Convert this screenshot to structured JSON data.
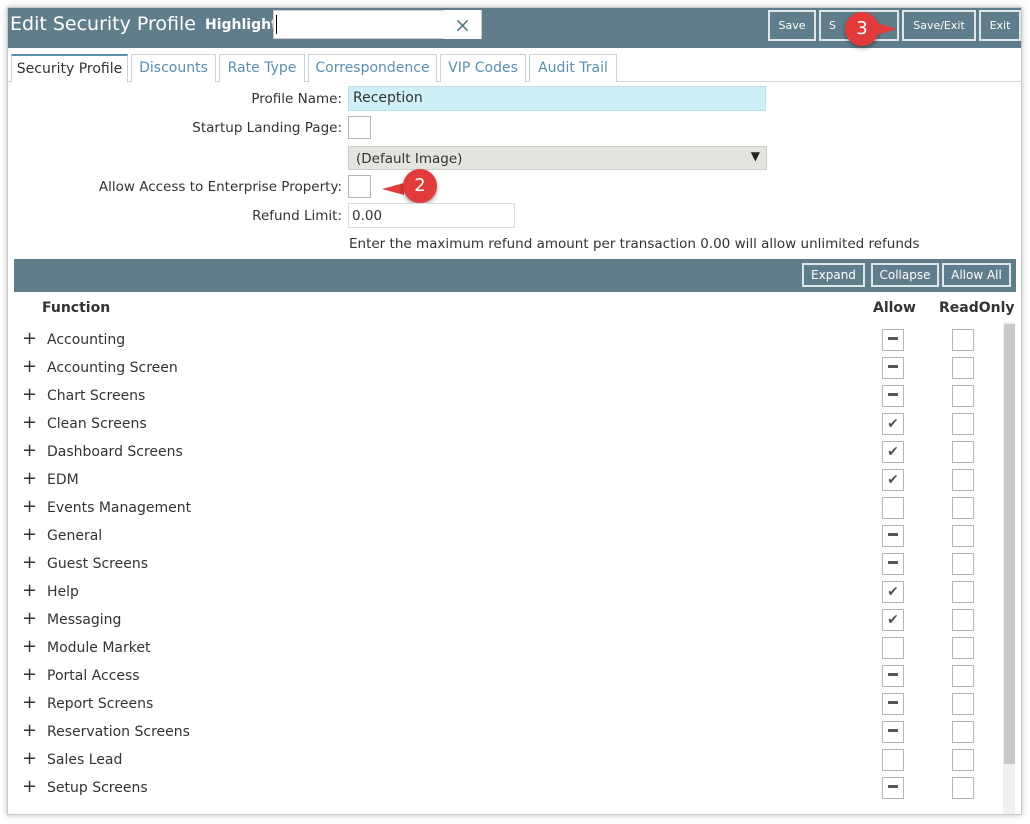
{
  "header": {
    "title": "Edit Security Profile",
    "highlight_label": "Highlight:",
    "highlight_value": "",
    "clear_icon": "×",
    "buttons": {
      "save": "Save",
      "save_partial": "S",
      "save_exit": "Save/Exit",
      "exit": "Exit"
    }
  },
  "callouts": {
    "save_exit": "3",
    "enterprise": "2"
  },
  "tabs": [
    {
      "label": "Security Profile",
      "active": true
    },
    {
      "label": "Discounts"
    },
    {
      "label": "Rate Type"
    },
    {
      "label": "Correspondence"
    },
    {
      "label": "VIP Codes"
    },
    {
      "label": "Audit Trail"
    }
  ],
  "form": {
    "profile_name_label": "Profile Name:",
    "profile_name_value": "Reception",
    "startup_label": "Startup Landing Page:",
    "default_image": "(Default Image)",
    "enterprise_label": "Allow Access to Enterprise Property:",
    "refund_label": "Refund Limit:",
    "refund_value": "0.00",
    "refund_hint": "Enter the maximum refund amount per transaction 0.00 will allow unlimited refunds"
  },
  "grid": {
    "expand": "Expand",
    "collapse": "Collapse",
    "allow_all": "Allow All",
    "col_function": "Function",
    "col_allow": "Allow",
    "col_readonly": "ReadOnly",
    "rows": [
      {
        "name": "Accounting",
        "allow": "partial"
      },
      {
        "name": "Accounting Screen",
        "allow": "partial"
      },
      {
        "name": "Chart Screens",
        "allow": "partial"
      },
      {
        "name": "Clean Screens",
        "allow": "checked"
      },
      {
        "name": "Dashboard Screens",
        "allow": "checked"
      },
      {
        "name": "EDM",
        "allow": "checked"
      },
      {
        "name": "Events Management",
        "allow": "empty"
      },
      {
        "name": "General",
        "allow": "partial"
      },
      {
        "name": "Guest Screens",
        "allow": "partial"
      },
      {
        "name": "Help",
        "allow": "checked"
      },
      {
        "name": "Messaging",
        "allow": "checked"
      },
      {
        "name": "Module Market",
        "allow": "empty"
      },
      {
        "name": "Portal Access",
        "allow": "partial"
      },
      {
        "name": "Report Screens",
        "allow": "partial"
      },
      {
        "name": "Reservation Screens",
        "allow": "partial"
      },
      {
        "name": "Sales Lead",
        "allow": "empty"
      },
      {
        "name": "Setup Screens",
        "allow": "partial"
      }
    ]
  },
  "colors": {
    "header": "#607d8b",
    "callout": "#e23b3b",
    "tab_link": "#5b8fb0",
    "profile_bg": "#cfeff9"
  }
}
